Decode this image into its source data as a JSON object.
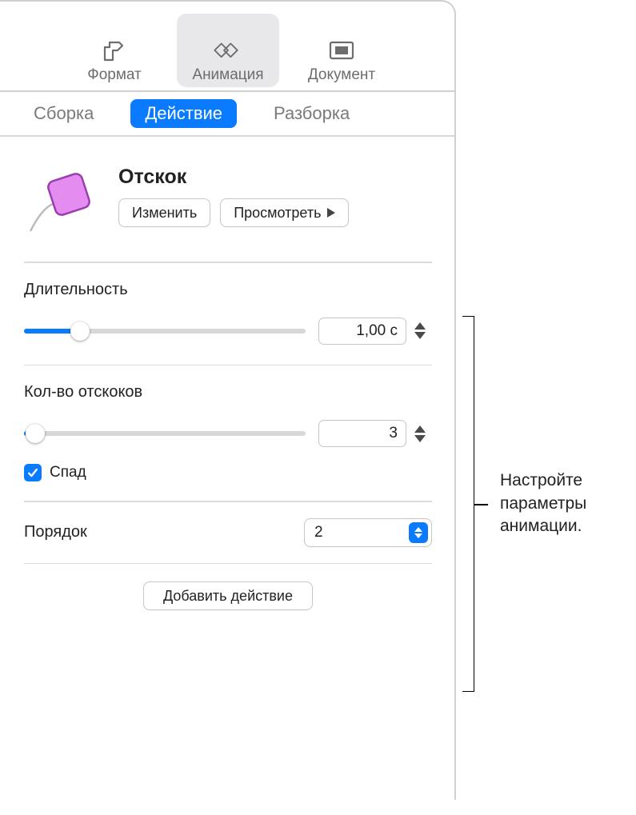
{
  "toolbar": {
    "format": "Формат",
    "animation": "Анимация",
    "document": "Документ"
  },
  "tabs": {
    "build_in": "Сборка",
    "action": "Действие",
    "build_out": "Разборка"
  },
  "effect": {
    "title": "Отскок",
    "change": "Изменить",
    "preview": "Просмотреть"
  },
  "duration": {
    "label": "Длительность",
    "value": "1,00 с",
    "slider_percent": 20
  },
  "bounces": {
    "label": "Кол-во отскоков",
    "value": "3",
    "slider_percent": 4,
    "decay_label": "Спад",
    "decay_checked": true
  },
  "order": {
    "label": "Порядок",
    "value": "2"
  },
  "add_action": "Добавить действие",
  "callout": "Настройте параметры анимации."
}
